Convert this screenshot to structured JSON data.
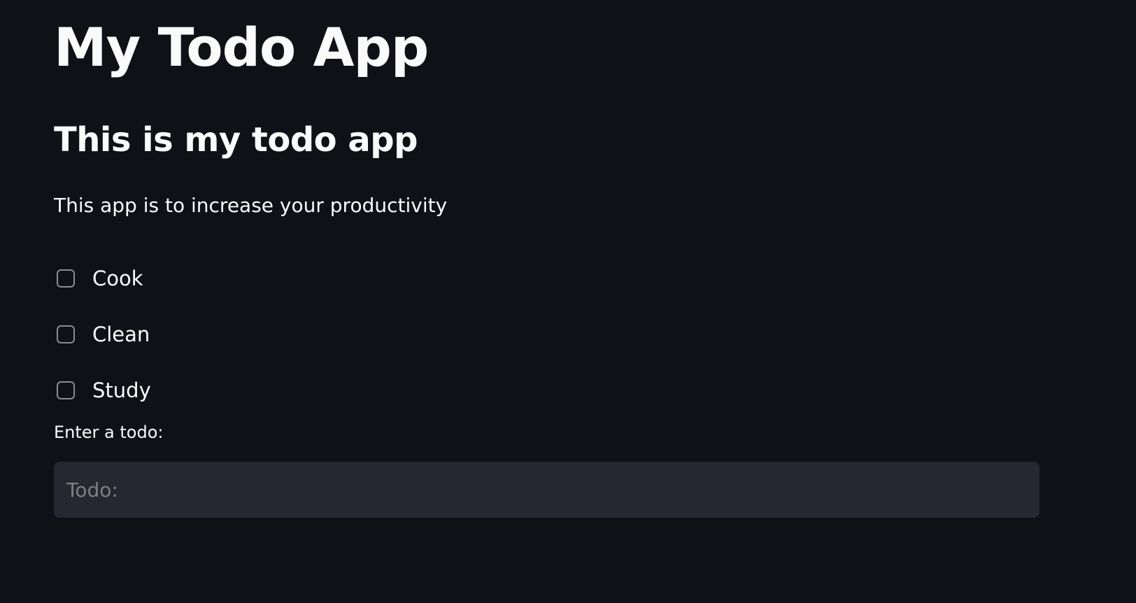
{
  "header": {
    "title": "My Todo App",
    "subtitle": "This is my todo app",
    "description": "This app is to increase your productivity"
  },
  "todos": [
    {
      "label": "Cook",
      "checked": false
    },
    {
      "label": "Clean",
      "checked": false
    },
    {
      "label": "Study",
      "checked": false
    }
  ],
  "input": {
    "label": "Enter a todo:",
    "placeholder": "Todo:",
    "value": ""
  },
  "colors": {
    "background": "#0f1117",
    "text": "#fafafa",
    "input_background": "#262730",
    "checkbox_border": "#8b8d94",
    "placeholder": "#7d7f86"
  }
}
